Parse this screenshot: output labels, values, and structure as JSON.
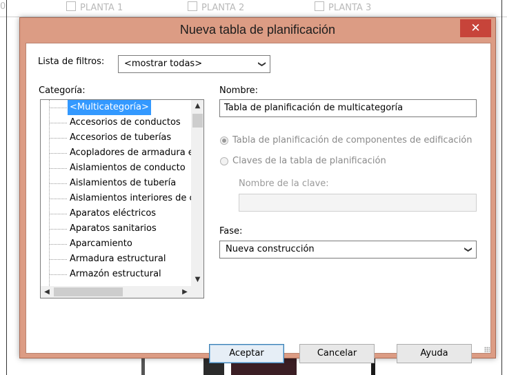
{
  "background": {
    "tabs": [
      "PLANTA 1",
      "PLANTA 2",
      "PLANTA 3"
    ],
    "left_fragment": "0"
  },
  "dialog": {
    "title": "Nueva tabla de planificación",
    "close_glyph": "✕",
    "filter": {
      "label": "Lista de filtros:",
      "value": "<mostrar todas>"
    },
    "category": {
      "label": "Categoría:",
      "items": [
        "<Multicategoría>",
        "Accesorios de conductos",
        "Accesorios de tuberías",
        "Acopladores de armadura est",
        "Aislamientos de conducto",
        "Aislamientos de tubería",
        "Aislamientos interiores de con",
        "Aparatos eléctricos",
        "Aparatos sanitarios",
        "Aparcamiento",
        "Armadura estructural",
        "Armazón estructural"
      ],
      "selected": "<Multicategoría>"
    },
    "name": {
      "label": "Nombre:",
      "value": "Tabla de planificación de multicategoría"
    },
    "radios": {
      "components": "Tabla de planificación de componentes de edificación",
      "keys": "Claves de la tabla de planificación"
    },
    "key_name": {
      "label": "Nombre de la clave:",
      "value": ""
    },
    "phase": {
      "label": "Fase:",
      "value": "Nueva construcción"
    },
    "buttons": {
      "ok": "Aceptar",
      "cancel": "Cancelar",
      "help": "Ayuda"
    }
  },
  "icons": {
    "chevron_down": "chevron-down-icon",
    "scroll_up": "▲",
    "scroll_down": "▼",
    "scroll_left": "◀",
    "scroll_right": "▶"
  },
  "colors": {
    "title_bar": "#dc9c84",
    "close_button": "#c7443a",
    "selection": "#3399ff"
  }
}
